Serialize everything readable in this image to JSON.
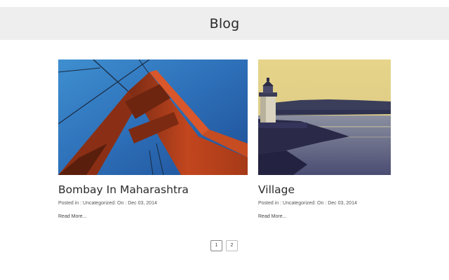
{
  "header": {
    "title": "Blog"
  },
  "posts": [
    {
      "title": "Bombay In Maharashtra",
      "meta": "Posted in : Uncategorized: On : Dec 03, 2014",
      "read_more": "Read More...",
      "image": "golden-gate-bridge-tower-photo"
    },
    {
      "title": "Village",
      "meta": "Posted in : Uncategorized: On : Dec 03, 2014",
      "read_more": "Read More...",
      "image": "lighthouse-harbor-photo"
    }
  ],
  "pagination": {
    "pages": [
      "1",
      "2"
    ],
    "current": "1"
  }
}
